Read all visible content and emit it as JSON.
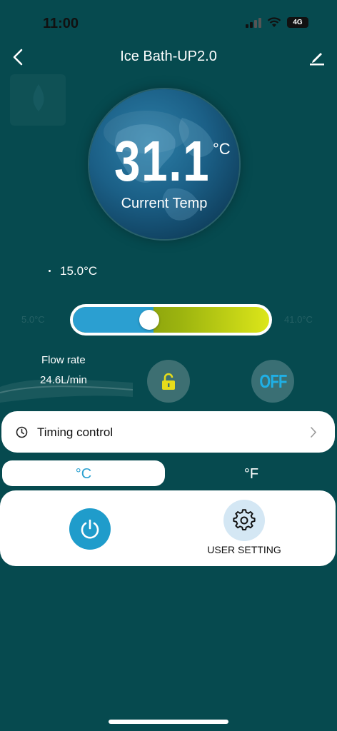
{
  "status_bar": {
    "time": "11:00",
    "network": "4G"
  },
  "nav": {
    "title": "Ice Bath-UP2.0",
    "back_icon": "chevron-left-icon",
    "edit_icon": "pencil-icon"
  },
  "temperature": {
    "current": "31.1",
    "unit": "°C",
    "label": "Current Temp",
    "set_point": "15.0°C"
  },
  "slider": {
    "min_label": "5.0°C",
    "max_label": "41.0°C",
    "level": 0.41
  },
  "flow": {
    "label": "Flow rate",
    "value": "24.6L/min"
  },
  "controls": {
    "lock_icon": "unlock-icon",
    "off_label": "OFF"
  },
  "timing": {
    "label": "Timing control",
    "icon": "clock-icon",
    "arrow_icon": "chevron-right-icon"
  },
  "units": {
    "celsius": "°C",
    "fahrenheit": "°F",
    "selected": "°C"
  },
  "bottom": {
    "power_icon": "power-icon",
    "settings_icon": "gear-icon",
    "settings_label": "USER SETTING"
  },
  "colors": {
    "background": "#064a4f",
    "accent": "#1f9ccb",
    "lock": "#e6dc1a",
    "off": "#1fb0e6"
  }
}
